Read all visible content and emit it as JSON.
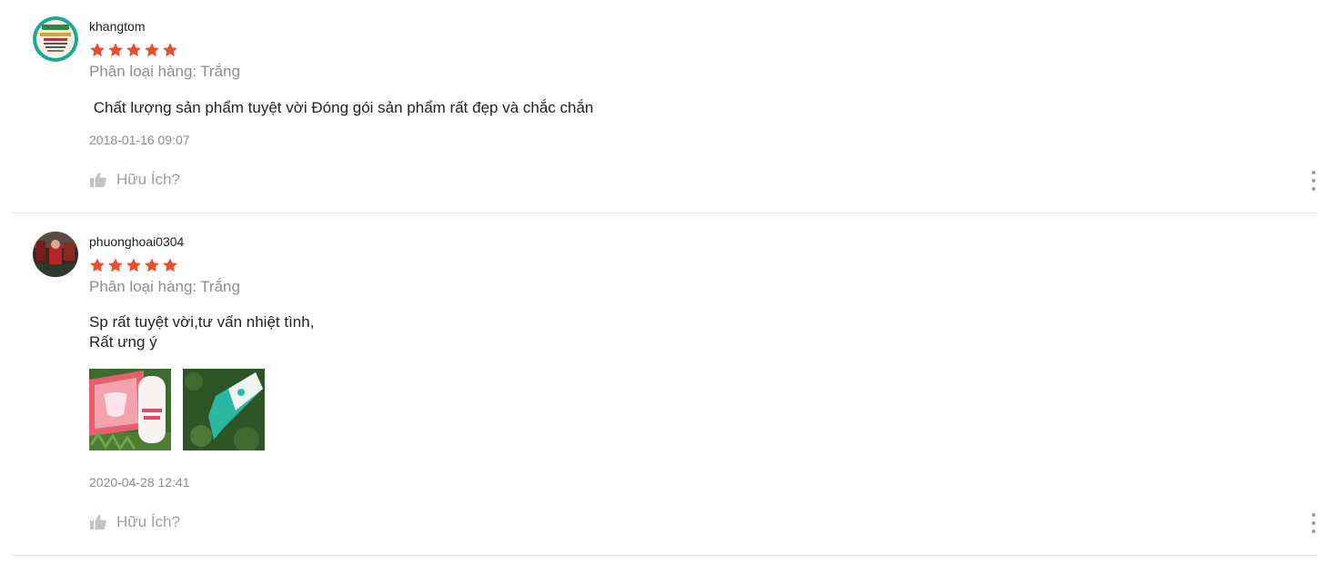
{
  "reviews": [
    {
      "author": "khangtom",
      "rating": 5,
      "variation_label": "Phân loại hàng:",
      "variation_value": "Trắng",
      "comment": " Chất lượng sản phẩm tuyệt vời Đóng gói sản phẩm rất đẹp và chắc chắn",
      "time": "2018-01-16 09:07",
      "helpful_label": "Hữu Ích?"
    },
    {
      "author": "phuonghoai0304",
      "rating": 5,
      "variation_label": "Phân loại hàng:",
      "variation_value": "Trắng",
      "comment": "Sp rất tuyệt vời,tư vấn nhiệt tình,\nRất ưng ý",
      "time": "2020-04-28 12:41",
      "helpful_label": "Hữu Ích?",
      "photos": [
        "photo-pink-box",
        "photo-teal-box"
      ]
    }
  ],
  "colors": {
    "star": "#ee4d2d",
    "muted_text": "#8e8e8e",
    "divider": "#e5e5e5"
  },
  "icons": {
    "star": "star-icon",
    "thumb": "thumbs-up-icon",
    "more": "more-vertical-icon"
  }
}
